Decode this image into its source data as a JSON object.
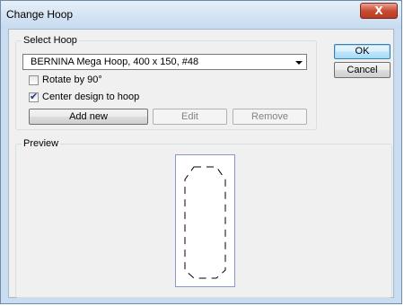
{
  "window": {
    "title": "Change Hoop"
  },
  "titlebar": {
    "close_icon": "close-x-icon",
    "close_glyph": "X",
    "close_color": "#c94b33"
  },
  "select_hoop": {
    "label": "Select Hoop",
    "dropdown": {
      "selected": "BERNINA Mega Hoop, 400 x 150, #48",
      "icon": "chevron-down-icon"
    },
    "rotate": {
      "label": "Rotate by 90°",
      "checked": false
    },
    "center": {
      "label": "Center design to hoop",
      "checked": true,
      "check_glyph": "✔"
    },
    "buttons": {
      "add_new": "Add new",
      "edit": "Edit",
      "remove": "Remove"
    }
  },
  "dialog_buttons": {
    "ok": "OK",
    "cancel": "Cancel"
  },
  "preview": {
    "label": "Preview",
    "hoop_outline_color": "#8c95cc",
    "design_stroke": "#000000"
  }
}
